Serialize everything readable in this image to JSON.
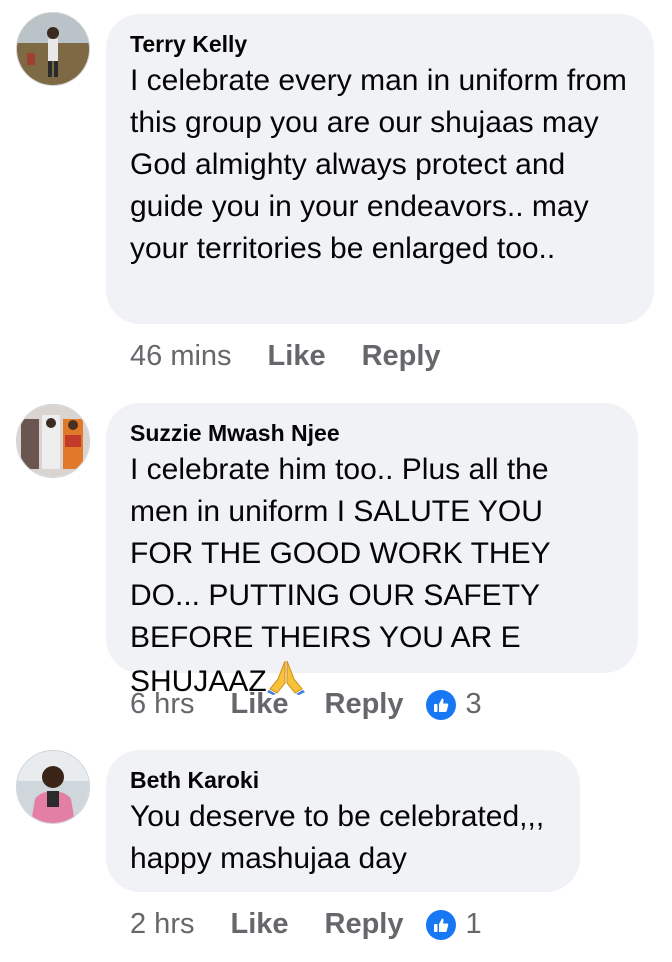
{
  "comments": [
    {
      "author": "Terry Kelly",
      "text": "I celebrate every man in uniform from this group you are our shujaas may God almighty always protect and guide you in your endeavors.. may your territories be enlarged too..",
      "time": "46 mins",
      "like_label": "Like",
      "reply_label": "Reply"
    },
    {
      "author": "Suzzie Mwash Njee",
      "text": "I celebrate him too.. Plus all the men in uniform I SALUTE YOU FOR THE GOOD WORK THEY DO... PUTTING OUR SAFETY BEFORE THEIRS  YOU AR E SHUJAAZ",
      "emoji": "folded-hands",
      "time": "6 hrs",
      "like_label": "Like",
      "reply_label": "Reply",
      "reaction_count": "3"
    },
    {
      "author": "Beth Karoki",
      "text": "You deserve to be celebrated,,, happy mashujaa day",
      "time": "2 hrs",
      "like_label": "Like",
      "reply_label": "Reply",
      "reaction_count": "1"
    }
  ],
  "colors": {
    "bubble": "#f0f2f5",
    "meta_text": "#65676b",
    "like_badge": "#1877f2"
  }
}
